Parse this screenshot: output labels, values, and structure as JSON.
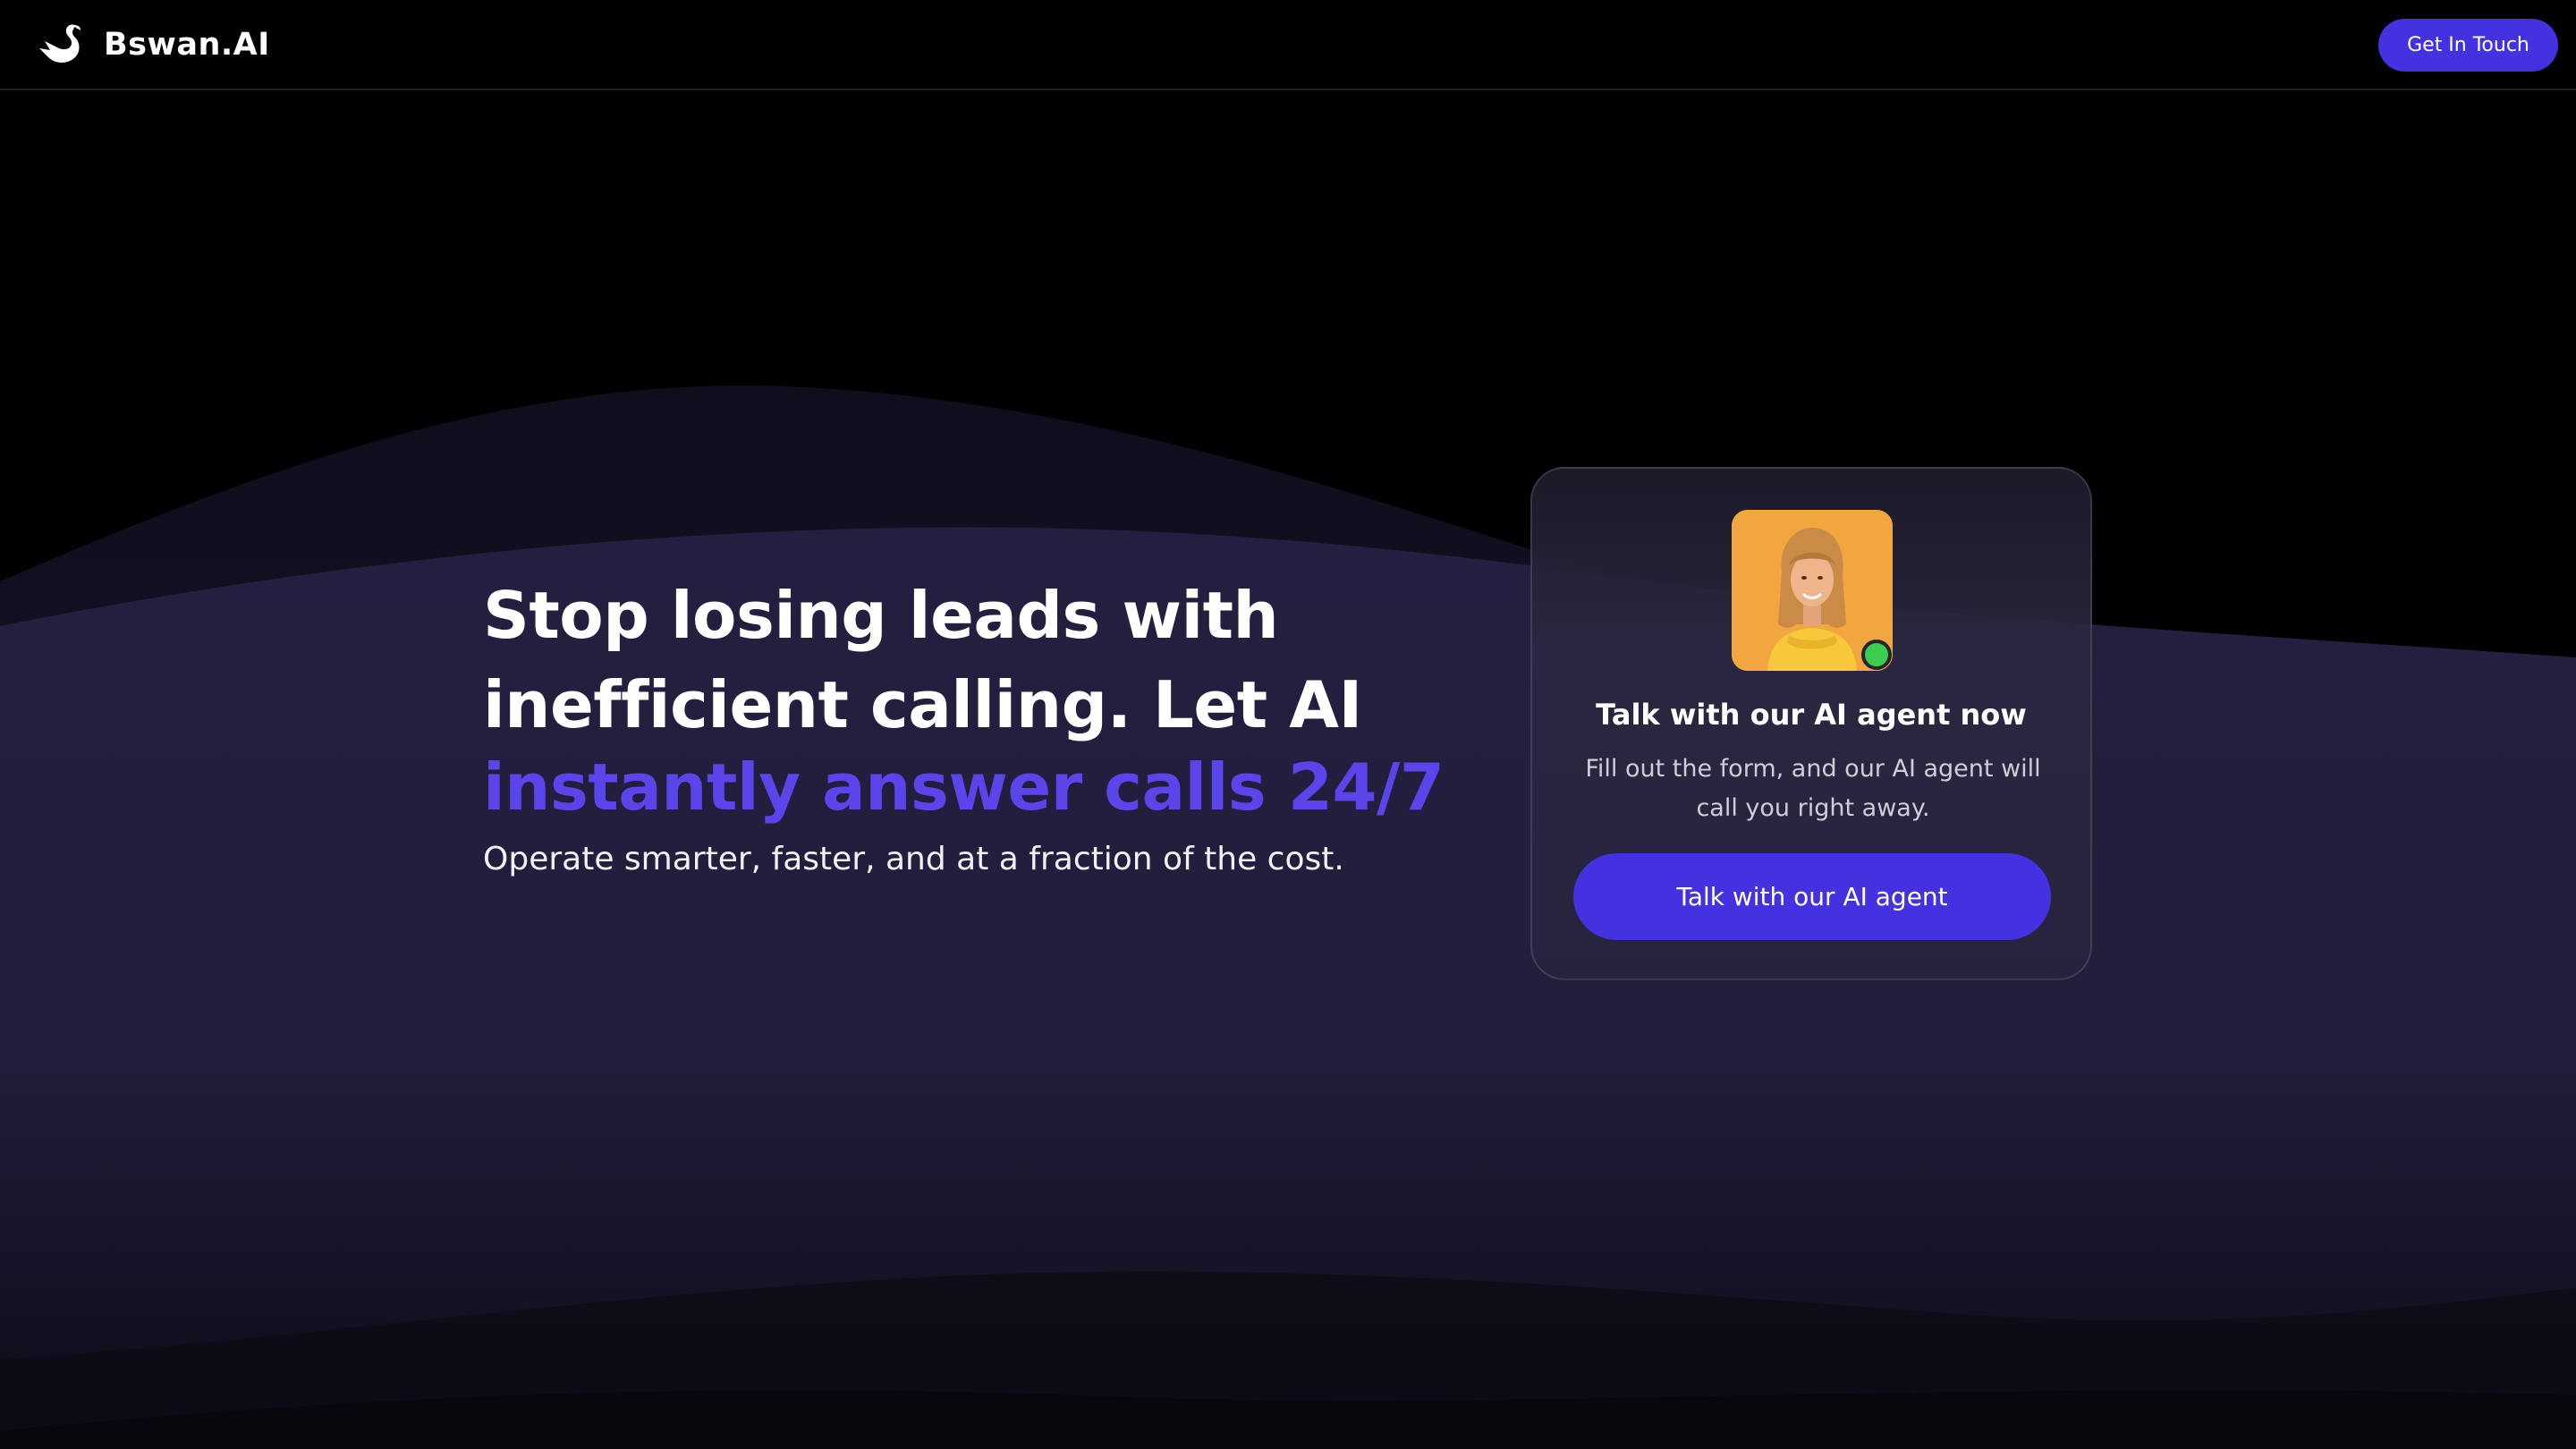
{
  "brand": {
    "name": "Bswan.AI",
    "logo_icon": "swan-logo-icon"
  },
  "nav": {
    "cta_label": "Get In Touch"
  },
  "hero": {
    "title_line_1": "Stop losing leads with",
    "title_line_2": "inefficient calling. Let AI",
    "title_accent": "instantly answer calls 24/7",
    "subtitle": "Operate smarter, faster, and at a fraction of the cost."
  },
  "agent_card": {
    "title": "Talk with our AI agent now",
    "description": "Fill out the form, and our AI agent will call you right away.",
    "button_label": "Talk with our AI agent",
    "status": "online"
  },
  "colors": {
    "background": "#000000",
    "accent": "#4431e0",
    "accent_text": "#5b45ea",
    "online": "#3ccd4e",
    "wave": "#231f3d"
  }
}
